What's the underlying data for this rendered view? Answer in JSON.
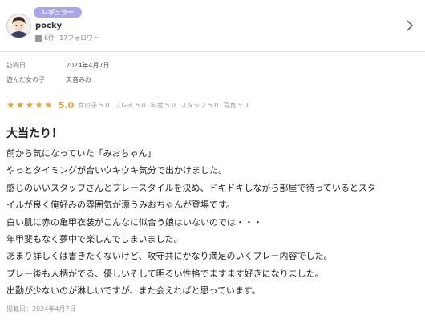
{
  "reviewer": {
    "badge": "レギュラー",
    "name": "pocky",
    "posts": "6件",
    "followers": "17フォロワー"
  },
  "visit": {
    "label": "訪問日",
    "value": "2024年4月7日"
  },
  "played": {
    "label": "遊んだ女の子",
    "value": "天音みお"
  },
  "rating": {
    "stars": "★★★★★",
    "overall": "5.0",
    "details": [
      "女の子 5.0",
      "プレイ 5.0",
      "料金 5.0",
      "スタッフ 5.0",
      "写真 5.0"
    ]
  },
  "review": {
    "title": "大当たり！",
    "lines": [
      "前から気になっていた「みおちゃん」",
      "やっとタイミングが合いウキウキ気分で出かけました。",
      "感じのいいスタッフさんとプレースタイルを決め、ドキドキしながら部屋で待っているとスタ",
      "イルが良く俺好みの雰囲気が漂うみおちゃんが登場です。",
      "白い肌に赤の亀甲衣装がこんなに似合う娘はいないのでは・・・",
      "年甲斐もなく夢中で楽しんでしまいました。",
      "あまり詳しくは書きたくないけど、攻守共にかなり満足のいくプレー内容でした。",
      "プレー後も人柄がでる、優しいそして明るい性格でますます好きになりました。",
      "出勤が少ないのが淋しいですが、また会えればと思っています。"
    ],
    "posted": "掲載日：2024年4月7日"
  }
}
